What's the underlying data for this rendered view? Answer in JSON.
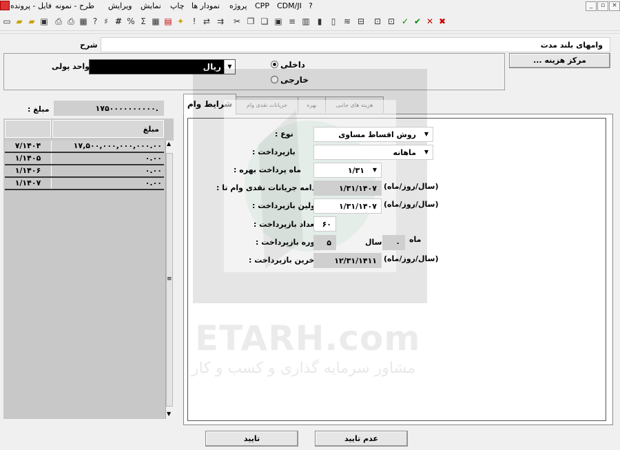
{
  "menu": [
    "فایل - پرونده",
    "طرح - نمونه",
    "ویرایش",
    "نمایش",
    "چاپ",
    "نمودار ها",
    "پروژه",
    "CPP",
    "CDM/JI",
    "?"
  ],
  "window_controls": {
    "minimize": "_",
    "restore": "▫",
    "close": "×"
  },
  "description": {
    "label": "شرح",
    "value": "وامهای بلند مدت"
  },
  "cost_center_button": "... مرکز هزینه",
  "currency": {
    "label": "واحد پولی",
    "value": "ریال"
  },
  "location": {
    "domestic": "داخلی",
    "foreign": "خارجی",
    "selected": "domestic"
  },
  "amount": {
    "label": ": مبلغ",
    "value": "۱۷۵۰۰۰۰۰۰۰۰۰۰."
  },
  "schedule": {
    "header_amount": "مبلغ",
    "rows": [
      {
        "date": "۷/۱۴۰۴",
        "amount": "۱۷,۵۰۰,۰۰۰,۰۰۰,۰۰۰.۰۰"
      },
      {
        "date": "۱/۱۴۰۵",
        "amount": "۰.۰۰"
      },
      {
        "date": "۱/۱۴۰۶",
        "amount": "۰.۰۰"
      },
      {
        "date": "۱/۱۴۰۷",
        "amount": "۰.۰۰"
      }
    ]
  },
  "tabs": [
    "شرایط وام",
    "جریانات نقدی وام",
    "بهره",
    "هزینه های جانبی"
  ],
  "form": {
    "type_label": ": نوع",
    "type_value": "روش اقساط مساوی",
    "repay_label": ": بازپرداخت",
    "repay_value": "ماهانه",
    "interest_month_label": ": ماه پرداخت بهره",
    "interest_month_value": "۱/۳۱",
    "cashflow_label": ": ادامه جریانات نقدی وام تا",
    "cashflow_value": "۱/۳۱/۱۴۰۷",
    "first_label": ": اولین بازپرداخت",
    "first_value": "۱/۳۱/۱۴۰۷",
    "count_label": ": تعداد بازپرداخت",
    "count_value": "۶۰",
    "period_label": ": دوره بازپرداخت",
    "period_years": "۵",
    "years_word": "سال",
    "period_months": "۰",
    "months_word": "ماه",
    "last_label": ": آخرین بازپرداخت",
    "last_value": "۱۲/۳۱/۱۴۱۱",
    "date_format": "(سال/روز/ماه)"
  },
  "watermark": {
    "brand": "ETARH.com",
    "tagline": "مشاور سرمایه گذاری و کسب و کار"
  },
  "buttons": {
    "cancel": "عدم تایید",
    "ok": "تایید"
  }
}
